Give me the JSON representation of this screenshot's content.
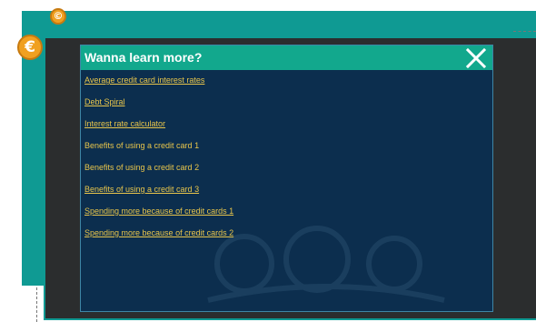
{
  "popup": {
    "title": "Wanna learn more?",
    "links": [
      {
        "label": "Average credit card interest rates",
        "underline": true
      },
      {
        "label": "Debt Spiral",
        "underline": true
      },
      {
        "label": "Interest rate calculator ",
        "underline": true
      },
      {
        "label": "Benefits of using a credit card 1",
        "underline": false
      },
      {
        "label": "Benefits of using a credit card 2",
        "underline": false
      },
      {
        "label": "Benefits of using a credit card 3",
        "underline": true
      },
      {
        "label": "Spending more because of credit cards 1",
        "underline": true
      },
      {
        "label": "Spending more because of credit cards 2",
        "underline": true
      }
    ]
  },
  "coins": {
    "small_symbol": "©",
    "large_symbol": "€"
  },
  "icons": {
    "close": "close-icon",
    "coin": "coin-icon"
  },
  "colors": {
    "teal_background": "#0f9a93",
    "header_green": "#12a88d",
    "panel_navy": "#0c2e4e",
    "link_gold": "#e8c54b",
    "frame_dark": "#2b2d2e"
  }
}
